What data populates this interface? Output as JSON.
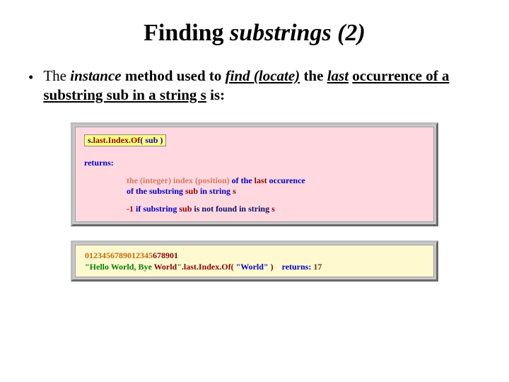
{
  "title": {
    "plain": "Finding ",
    "emph": "substrings (2)"
  },
  "bullet": {
    "t1": "The ",
    "t2": "instance",
    "t3": " method used to ",
    "t4": "find (locate)",
    "t5": " the ",
    "t6": "last",
    "t7": " ",
    "t8": "occurrence of a substring sub in a string s",
    "t9": " is:"
  },
  "panel1": {
    "sig": {
      "s": "s.",
      "m": "last.Index.Of",
      "p": "( sub )"
    },
    "returns": "returns:",
    "l1": {
      "a": "the (integer) index (position)",
      "b": " of the ",
      "c": "last",
      "d": " occurence"
    },
    "l2": {
      "a": "of the substring ",
      "b": "sub",
      "c": " in string ",
      "d": "s"
    },
    "l3": {
      "a": "-1",
      "b": " if substring ",
      "c": "sub",
      "d": " is not found in string ",
      "e": "s"
    }
  },
  "panel2": {
    "idx": {
      "a": "0123456789012345",
      "b": "678901"
    },
    "ex": {
      "a": "\"Hello World, Bye ",
      "b": "World",
      "c": "\"",
      "d": ".last.Index.Of( ",
      "e": "\"World\"",
      "f": " )",
      "g": "returns: ",
      "h": "17"
    }
  }
}
